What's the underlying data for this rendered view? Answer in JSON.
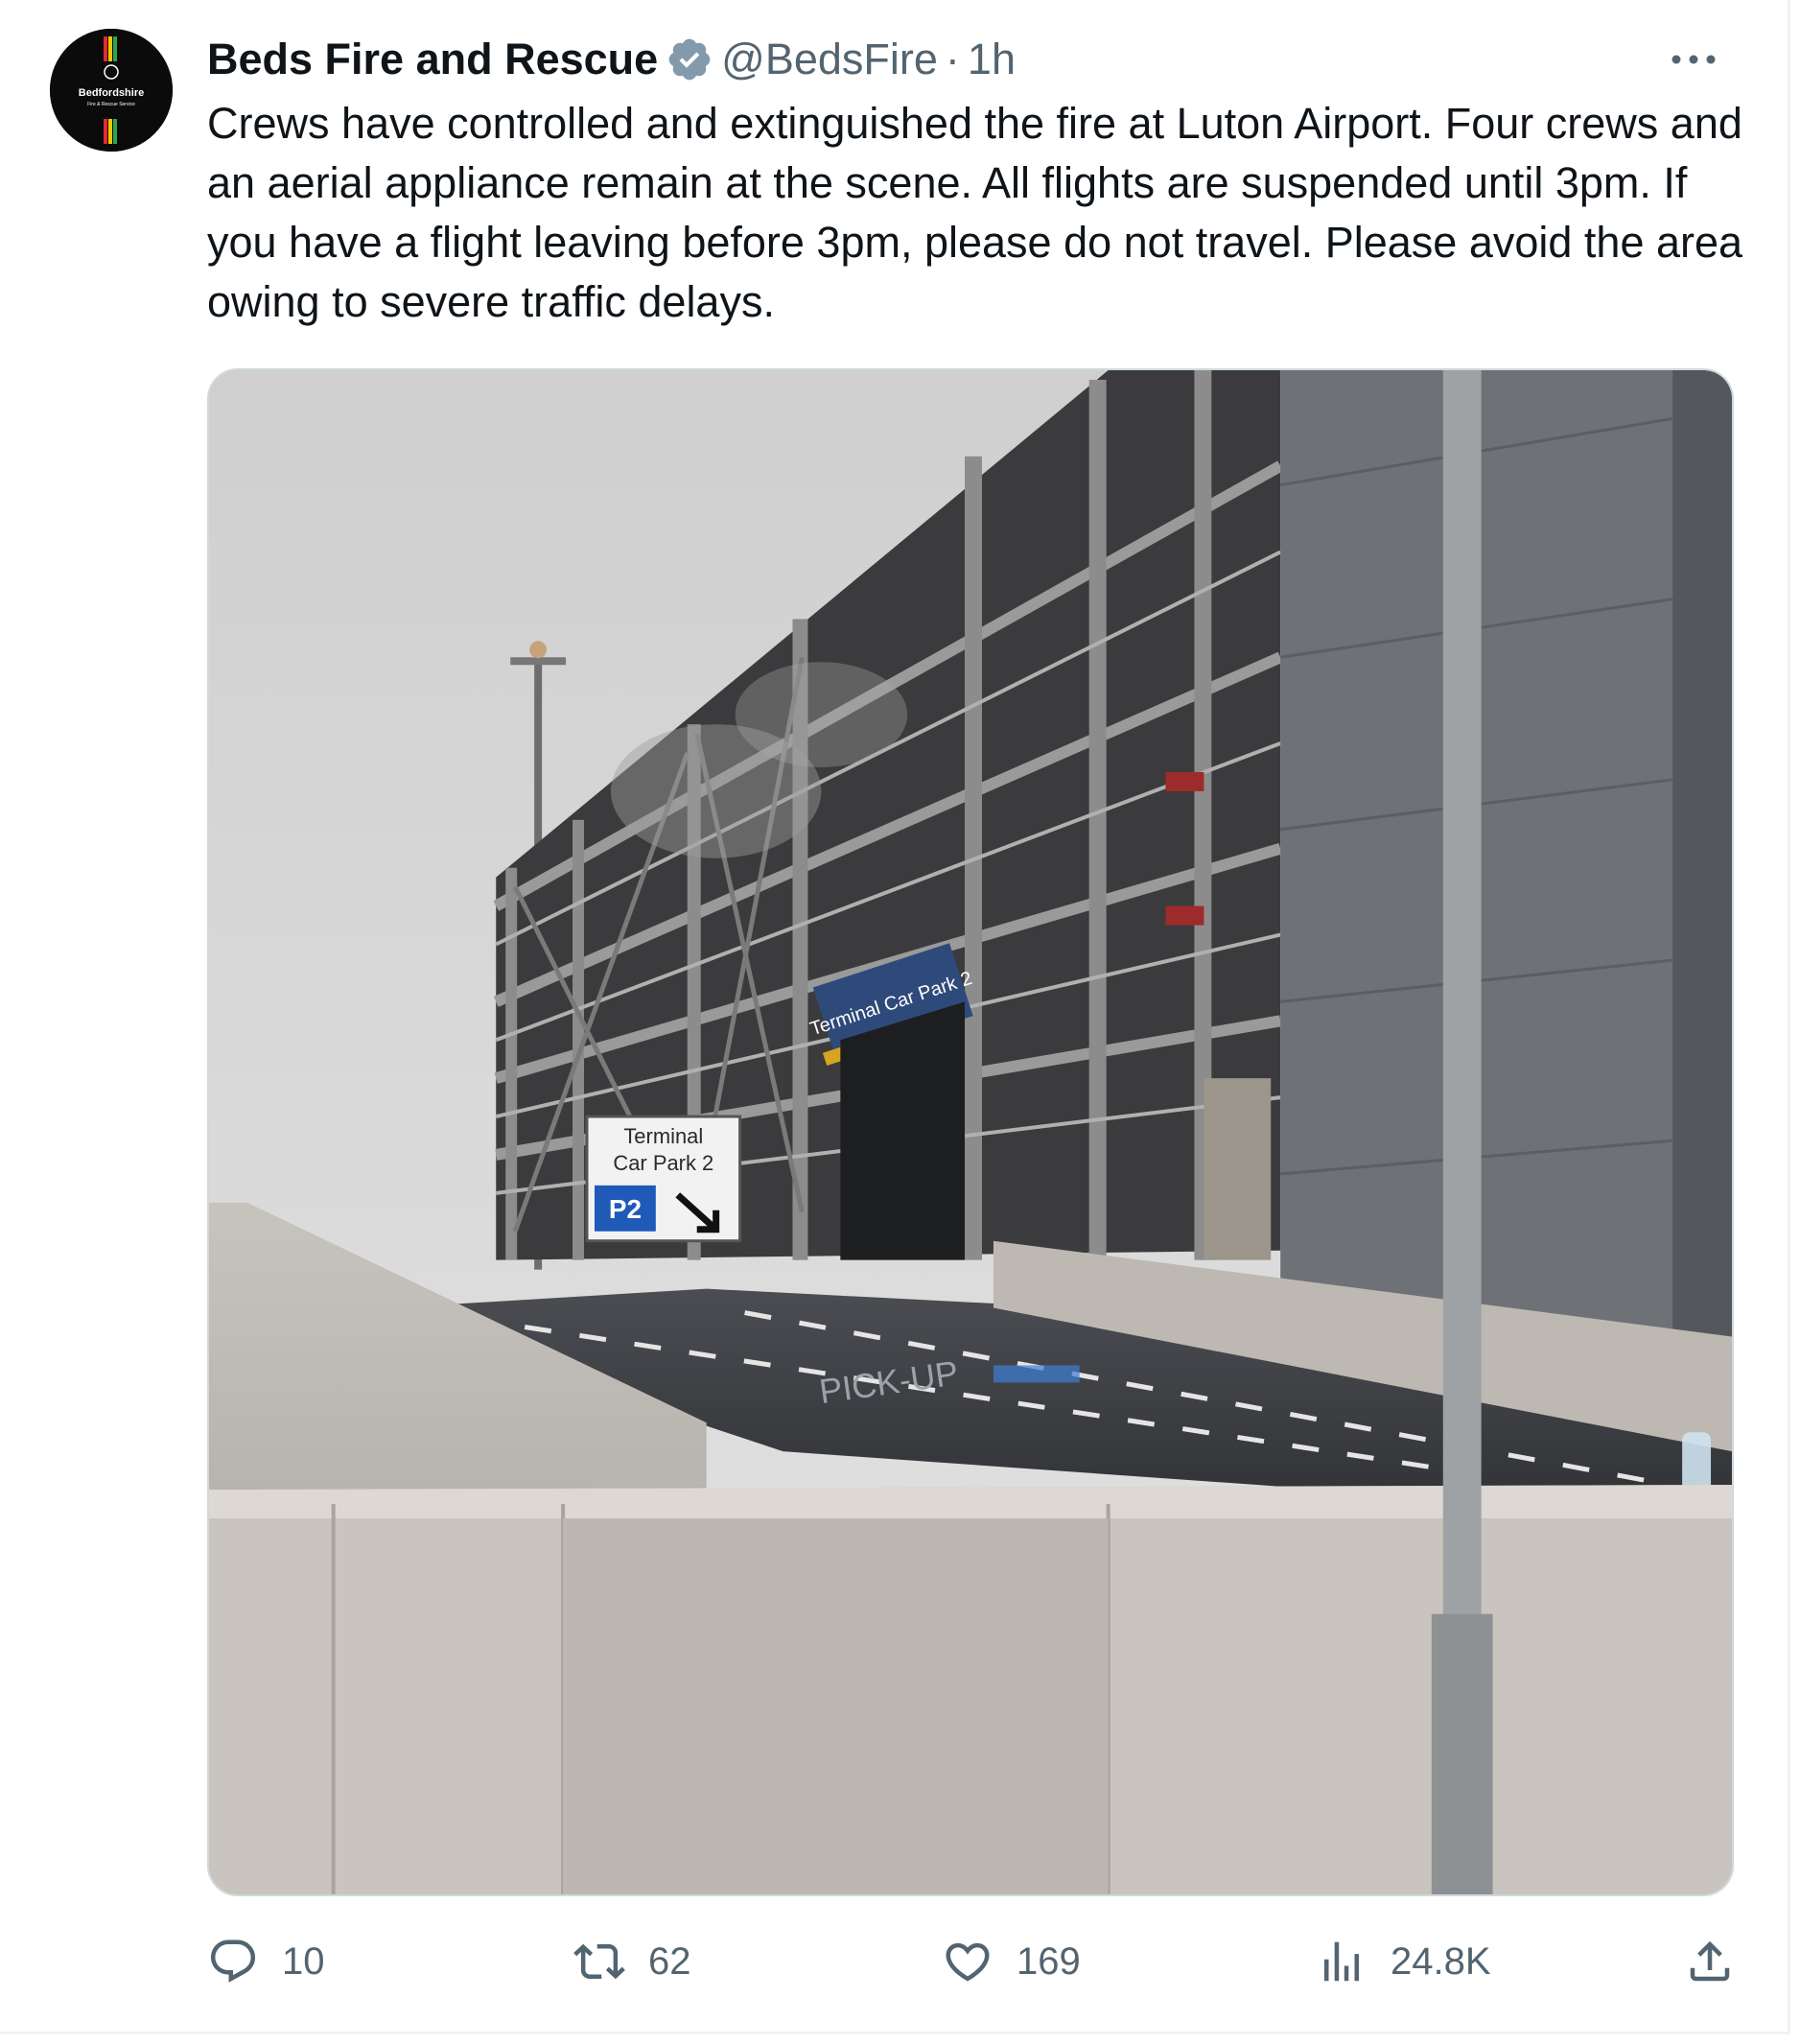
{
  "author": {
    "name": "Beds Fire and Rescue",
    "handle": "@BedsFire",
    "separator": "·",
    "time": "1h",
    "avatar_text": "Bedfordshire",
    "avatar_subtext": "Fire & Rescue Service",
    "verified_color": "#829aab"
  },
  "tweet": {
    "text": "Crews have controlled and extinguished the fire at Luton Airport. Four crews and an aerial appliance remain at the scene. All flights are suspended until 3pm. If you have a flight leaving before 3pm, please do not travel. Please avoid the area owing to severe traffic delays."
  },
  "media": {
    "sign_line1": "Terminal",
    "sign_line2": "Car Park 2",
    "sign_badge": "P2",
    "facade_sign": "Terminal Car Park 2",
    "road_marking": "PICK-UP"
  },
  "actions": {
    "replies": "10",
    "reposts": "62",
    "likes": "169",
    "views": "24.8K"
  },
  "icons": [
    "verified-icon",
    "more-icon",
    "reply-icon",
    "repost-icon",
    "like-icon",
    "views-icon",
    "share-icon"
  ],
  "colors": {
    "text": "#0f1419",
    "secondary": "#536471",
    "border": "#eff3f4"
  }
}
